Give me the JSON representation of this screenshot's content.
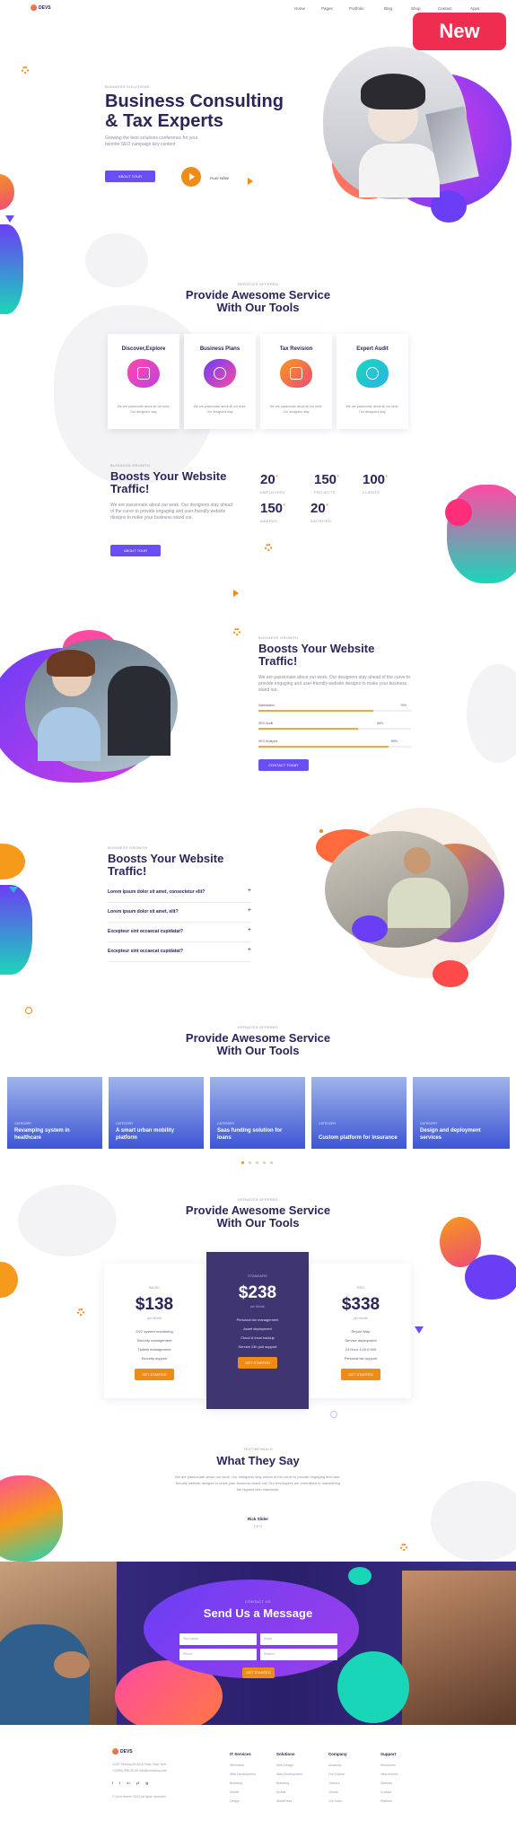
{
  "header": {
    "logo_text": "DEVS",
    "nav": [
      "Home",
      "Pages",
      "Portfolio",
      "Blog",
      "Shop",
      "Contact",
      "Apps"
    ],
    "badge": "New"
  },
  "hero": {
    "tag": "BUSINESS SOLUTIONS",
    "title_line1": "Business Consulting",
    "title_line2": "& Tax Experts",
    "subtitle_line1": "Growing the best solutions conference for your",
    "subtitle_line2": "favorite SEO campaign key content",
    "cta_label": "ABOUT TOUR",
    "play_label": "PLAY NOW"
  },
  "services": {
    "tag": "SERVICES OFFERED",
    "title_line1": "Provide Awesome Service",
    "title_line2": "With Our Tools",
    "items": [
      {
        "title": "Discover,Explore",
        "desc": "We are passionate about all our work. Our designers stay"
      },
      {
        "title": "Business Plans",
        "desc": "We are passionate about all our work. Our designers stay"
      },
      {
        "title": "Tax Revision",
        "desc": "We are passionate about all our work. Our designers stay"
      },
      {
        "title": "Expert Audit",
        "desc": "We are passionate about all our work. Our designers stay"
      }
    ]
  },
  "stats": {
    "tag": "BUSINESS GROWTH",
    "title_line1": "Boosts Your Website",
    "title_line2": "Traffic!",
    "body": "We are passionate about our work. Our designers stay ahead of the curve to provide engaging and user-friendly website designs to make your business stand out.",
    "cta_label": "ABOUT TOUR",
    "items": [
      {
        "value": "20",
        "sup": "+",
        "label": "EMPLOYEES"
      },
      {
        "value": "150",
        "sup": "+",
        "label": "PROJECTS"
      },
      {
        "value": "100",
        "sup": "+",
        "label": "CLIENTS"
      },
      {
        "value": "150",
        "sup": "+",
        "label": "AWARDS"
      },
      {
        "value": "20",
        "sup": "+",
        "label": "SATISFIED"
      }
    ]
  },
  "skills": {
    "tag": "BUSINESS GROWTH",
    "title_line1": "Boosts Your Website",
    "title_line2": "Traffic!",
    "body": "We are passionate about our work. Our designers stay ahead of the curve to provide engaging and user-friendly website designs to make your business stand out.",
    "cta_label": "CONTACT TODAY",
    "bars": [
      {
        "label": "Satisfaction",
        "pct_label": "75%",
        "pct": 75
      },
      {
        "label": "SEO Audit",
        "pct_label": "65%",
        "pct": 65
      },
      {
        "label": "SEO Analysis",
        "pct_label": "85%",
        "pct": 85
      }
    ]
  },
  "faq": {
    "tag": "BUSINESS GROWTH",
    "title_line1": "Boosts Your Website",
    "title_line2": "Traffic!",
    "items": [
      "Lorem ipsum dolor sit amet, consectetur elit?",
      "Lorem ipsum dolor sit amet, elit?",
      "Excepteur sint occaecat cupidatat?",
      "Excepteur sint occaecat cupidatat?"
    ]
  },
  "projects": {
    "tag": "SERVICES OFFERED",
    "title_line1": "Provide Awesome Service",
    "title_line2": "With Our Tools",
    "items": [
      {
        "category": "CATEGORY",
        "title": "Revamping system in healthcare"
      },
      {
        "category": "CATEGORY",
        "title": "A smart urban mobility platform"
      },
      {
        "category": "CATEGORY",
        "title": "Saas funding solution for loans"
      },
      {
        "category": "CATEGORY",
        "title": "Custom platform for insurance"
      },
      {
        "category": "CATEGORY",
        "title": "Design and deployment services"
      }
    ]
  },
  "pricing": {
    "tag": "SERVICES OFFERED",
    "title_line1": "Provide Awesome Service",
    "title_line2": "With Our Tools",
    "plans": [
      {
        "name": "BASIC",
        "price": "$138",
        "period": "per Month",
        "features": [
          "24/7 system monitoring",
          "Security management",
          "Tickets management",
          "Security support"
        ],
        "cta": "GET STARTED"
      },
      {
        "name": "STANDARD",
        "price": "$238",
        "period": "per Month",
        "features": [
          "Personal tax management",
          "Asset deployment",
          "Cloud & local backup",
          "Service 24h poll support"
        ],
        "cta": "GET STARTED"
      },
      {
        "name": "PRO",
        "price": "$338",
        "period": "per Month",
        "features": [
          "Report Map",
          "Service deployment",
          "24 Hour 1,00,0,000",
          "Personal tax support"
        ],
        "cta": "GET STARTED"
      }
    ]
  },
  "testimonial": {
    "tag": "TESTIMONIALS",
    "title": "What They Say",
    "body_line1": "We are passionate about our work. Our designers stay ahead of the curve to provide engaging and user-",
    "body_line2": "friendly website designs to make your business stand out. Our developers are committed to maintaining",
    "body_line3": "the highest web standards.",
    "name": "Rick Slider",
    "role": "CEO"
  },
  "contact": {
    "tag": "CONTACT US",
    "title": "Send Us a Message",
    "fields": [
      "Your name",
      "Email",
      "Phone",
      "Subject"
    ],
    "cta_label": "GET STARTED"
  },
  "footer": {
    "logo_text": "DEVS",
    "address_line1": "10/07 Stoking AK/ULA Suite, New York",
    "address_line2": "+1(555) 555-55-55 info@company.com",
    "social": [
      "f",
      "t",
      "in",
      "yt",
      "ig"
    ],
    "copyright": "© Devs theme 2023 all rights reserved",
    "columns": [
      {
        "heading": "IT Services",
        "items": [
          "Wireframe",
          "Web Development",
          "Branding",
          "Mobile",
          "Design"
        ]
      },
      {
        "heading": "Solutions",
        "items": [
          "Web Design",
          "Web Development",
          "Branding",
          "Mobile",
          "WordPress"
        ]
      },
      {
        "heading": "Company",
        "items": [
          "Academy",
          "Our Culture",
          "Careers",
          "Clients",
          "Our Team"
        ]
      },
      {
        "heading": "Support",
        "items": [
          "Resources",
          "Help Articles",
          "Sitemap",
          "Contact",
          "Platform"
        ]
      }
    ]
  }
}
